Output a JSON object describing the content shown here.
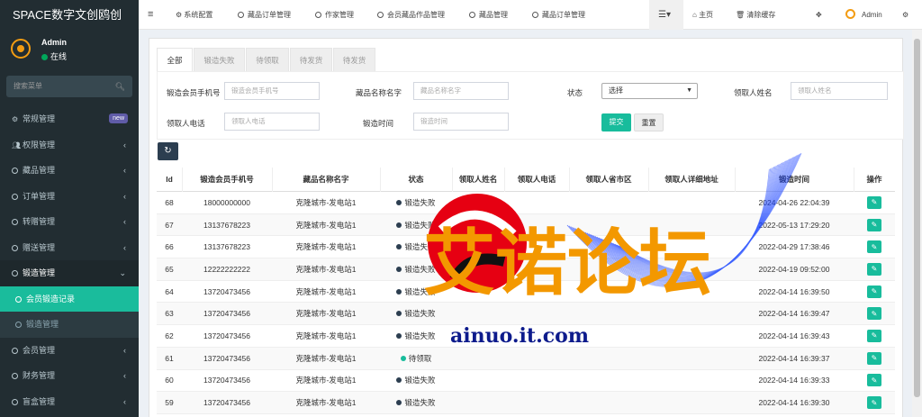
{
  "brand": "SPACE数字文创鸥创",
  "user": {
    "name": "Admin",
    "status": "在线"
  },
  "sidebar_search_placeholder": "搜索菜单",
  "sidebar": [
    {
      "label": "常规管理",
      "icon": "gears-icon",
      "badge": "new"
    },
    {
      "label": "权限管理",
      "icon": "users-icon",
      "chevron": "‹"
    },
    {
      "label": "藏品管理",
      "chevron": "‹"
    },
    {
      "label": "订单管理",
      "chevron": "‹"
    },
    {
      "label": "转赠管理",
      "chevron": "‹"
    },
    {
      "label": "赠送管理",
      "chevron": "‹"
    },
    {
      "label": "锻造管理",
      "chevron": "⌄"
    },
    {
      "label": "会员锻造记录"
    },
    {
      "label": "锻造管理"
    },
    {
      "label": "会员管理",
      "chevron": "‹"
    },
    {
      "label": "财务管理",
      "chevron": "‹"
    },
    {
      "label": "盲盒管理",
      "chevron": "‹"
    }
  ],
  "topnav": {
    "items": [
      "系统配置",
      "藏品订单管理",
      "作家管理",
      "会员藏品作品管理",
      "藏品管理",
      "藏品订单管理"
    ],
    "home": "主页",
    "clear_cache": "清除缓存",
    "admin": "Admin"
  },
  "tabs": [
    "全部",
    "锻造失败",
    "待领取",
    "待发货",
    "待发货"
  ],
  "filters": {
    "phone_label": "锻造会员手机号",
    "phone_placeholder": "锻造会员手机号",
    "collection_label": "藏品名称名字",
    "collection_placeholder": "藏品名称名字",
    "status_label": "状态",
    "status_value": "选择",
    "receiver_name_label": "领取人姓名",
    "receiver_name_placeholder": "领取人姓名",
    "receiver_phone_label": "领取人电话",
    "receiver_phone_placeholder": "领取人电话",
    "time_label": "锻造时间",
    "time_placeholder": "锻造时间",
    "submit": "提交",
    "reset": "重置"
  },
  "table": {
    "headers": [
      "Id",
      "锻造会员手机号",
      "藏品名称名字",
      "状态",
      "领取人姓名",
      "领取人电话",
      "领取人省市区",
      "领取人详细地址",
      "锻造时间",
      "操作"
    ],
    "rows": [
      {
        "id": "68",
        "phone": "18000000000",
        "name": "克隆城市-发电站1",
        "status": "锻造失败",
        "time": "2024-04-26 22:04:39"
      },
      {
        "id": "67",
        "phone": "13137678223",
        "name": "克隆城市-发电站1",
        "status": "锻造失败",
        "time": "2022-05-13 17:29:20"
      },
      {
        "id": "66",
        "phone": "13137678223",
        "name": "克隆城市-发电站1",
        "status": "锻造失败",
        "time": "2022-04-29 17:38:46"
      },
      {
        "id": "65",
        "phone": "12222222222",
        "name": "克隆城市-发电站1",
        "status": "锻造失败",
        "time": "2022-04-19 09:52:00"
      },
      {
        "id": "64",
        "phone": "13720473456",
        "name": "克隆城市-发电站1",
        "status": "锻造失败",
        "time": "2022-04-14 16:39:50"
      },
      {
        "id": "63",
        "phone": "13720473456",
        "name": "克隆城市-发电站1",
        "status": "锻造失败",
        "time": "2022-04-14 16:39:47"
      },
      {
        "id": "62",
        "phone": "13720473456",
        "name": "克隆城市-发电站1",
        "status": "锻造失败",
        "time": "2022-04-14 16:39:43"
      },
      {
        "id": "61",
        "phone": "13720473456",
        "name": "克隆城市-发电站1",
        "status": "待领取",
        "time": "2022-04-14 16:39:37"
      },
      {
        "id": "60",
        "phone": "13720473456",
        "name": "克隆城市-发电站1",
        "status": "锻造失败",
        "time": "2022-04-14 16:39:33"
      },
      {
        "id": "59",
        "phone": "13720473456",
        "name": "克隆城市-发电站1",
        "status": "锻造失败",
        "time": "2022-04-14 16:39:30"
      }
    ]
  },
  "watermark": {
    "title": "艾诺论坛",
    "url": "ainuo.it.com"
  },
  "colors": {
    "accent": "#18bc9c",
    "sidebar": "#222d32",
    "watermark_orange": "#f39800",
    "watermark_red": "#e60012"
  }
}
